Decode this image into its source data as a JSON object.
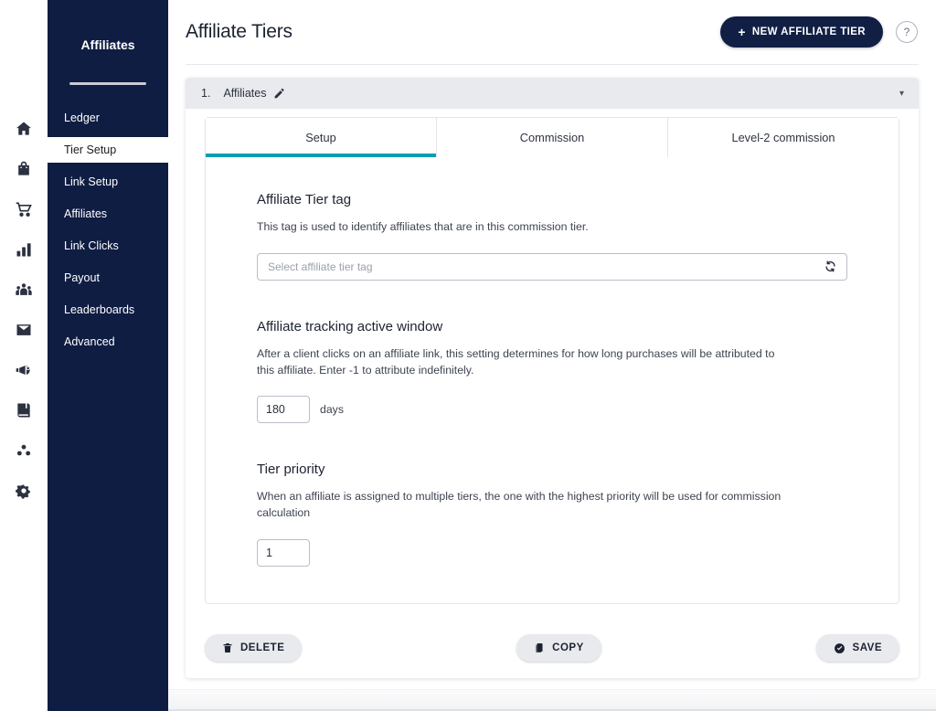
{
  "sidebar": {
    "title": "Affiliates",
    "items": [
      {
        "label": "Ledger",
        "active": false
      },
      {
        "label": "Tier Setup",
        "active": true
      },
      {
        "label": "Link Setup",
        "active": false
      },
      {
        "label": "Affiliates",
        "active": false
      },
      {
        "label": "Link Clicks",
        "active": false
      },
      {
        "label": "Payout",
        "active": false
      },
      {
        "label": "Leaderboards",
        "active": false
      },
      {
        "label": "Advanced",
        "active": false
      }
    ],
    "background_color": "#0f1d43"
  },
  "icon_rail": {
    "icons": [
      "home-icon",
      "shopping-bag-icon",
      "shopping-cart-icon",
      "bar-chart-icon",
      "people-group-icon",
      "envelope-icon",
      "megaphone-icon",
      "book-icon",
      "affiliates-dots-icon",
      "gear-icon"
    ]
  },
  "header": {
    "title": "Affiliate Tiers",
    "new_tier_label": "NEW AFFILIATE TIER",
    "new_tier_plus": "+",
    "help_label": "?",
    "primary_color": "#111f45"
  },
  "accordion": {
    "number": "1.",
    "label": "Affiliates",
    "caret": "▾"
  },
  "tabs": [
    {
      "label": "Setup",
      "active": true
    },
    {
      "label": "Commission",
      "active": false
    },
    {
      "label": "Level-2 commission",
      "active": false
    }
  ],
  "tab_accent_color": "#00a0b4",
  "sections": [
    {
      "title": "Affiliate Tier tag",
      "description": "This tag is used to identify affiliates that are in this commission tier.",
      "field": {
        "type": "select",
        "placeholder": "Select affiliate tier tag",
        "value": "",
        "icon": "refresh-icon"
      }
    },
    {
      "title": "Affiliate tracking active window",
      "description": "After a client clicks on an affiliate link, this setting determines for how long purchases will be attributed to this affiliate. Enter -1 to attribute indefinitely.",
      "field": {
        "type": "number",
        "value": "180",
        "unit": "days"
      }
    },
    {
      "title": "Tier priority",
      "description": "When an affiliate is assigned to multiple tiers, the one with the highest priority will be used for commission calculation",
      "field": {
        "type": "number",
        "value": "1",
        "unit": ""
      }
    }
  ],
  "actions": {
    "delete_label": "DELETE",
    "copy_label": "COPY",
    "save_label": "SAVE"
  }
}
